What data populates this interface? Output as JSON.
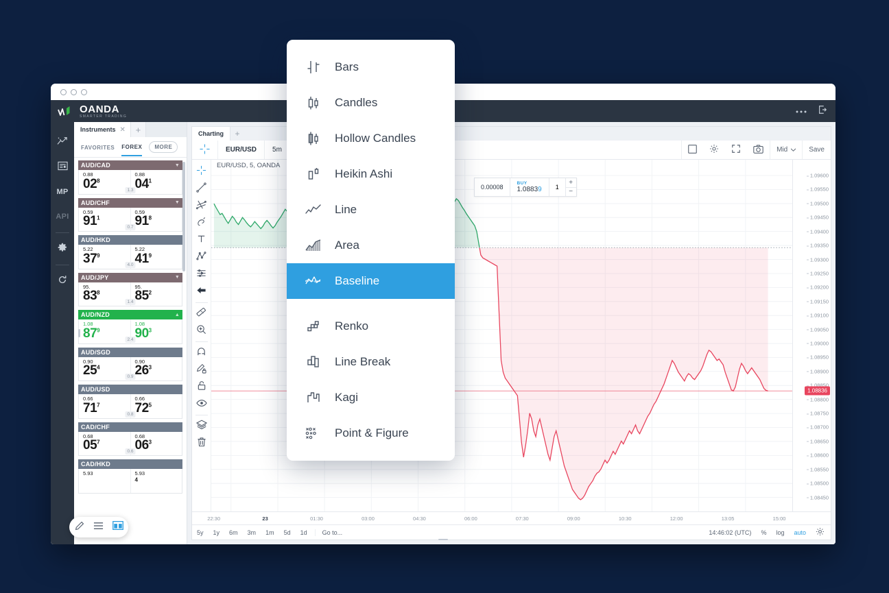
{
  "app": {
    "brand_name": "OANDA",
    "brand_tagline": "SMARTER TRADING",
    "more_icon": "ellipsis-icon",
    "logout_icon": "logout-icon"
  },
  "rail": {
    "items": [
      {
        "name": "rates-icon",
        "label": ""
      },
      {
        "name": "news-icon",
        "label": ""
      },
      {
        "name": "marketpulse-label",
        "label": "MP"
      },
      {
        "name": "api-label",
        "label": "API"
      },
      {
        "name": "settings-icon",
        "label": ""
      },
      {
        "name": "refresh-icon",
        "label": ""
      }
    ]
  },
  "instruments_panel": {
    "tab_label": "Instruments",
    "close_icon": "close-icon",
    "add_tab_icon": "plus-icon",
    "subtabs": [
      {
        "label": "FAVORITES",
        "active": false
      },
      {
        "label": "FOREX",
        "active": true
      },
      {
        "label": "MORE",
        "active": false
      }
    ],
    "rows": [
      {
        "symbol": "AUD/CAD",
        "dir": "down",
        "bid_pre": "0.88",
        "bid_big": "02",
        "bid_sup": "8",
        "ask_pre": "0.88",
        "ask_big": "04",
        "ask_sup": "1",
        "spread": "1.3"
      },
      {
        "symbol": "AUD/CHF",
        "dir": "down",
        "bid_pre": "0.59",
        "bid_big": "91",
        "bid_sup": "1",
        "ask_pre": "0.59",
        "ask_big": "91",
        "ask_sup": "8",
        "spread": "0.7"
      },
      {
        "symbol": "AUD/HKD",
        "dir": "flat",
        "bid_pre": "5.22",
        "bid_big": "37",
        "bid_sup": "9",
        "ask_pre": "5.22",
        "ask_big": "41",
        "ask_sup": "9",
        "spread": "4.0"
      },
      {
        "symbol": "AUD/JPY",
        "dir": "down",
        "bid_pre": "95.",
        "bid_big": "83",
        "bid_sup": "8",
        "ask_pre": "95.",
        "ask_big": "85",
        "ask_sup": "2",
        "spread": "1.4"
      },
      {
        "symbol": "AUD/NZD",
        "dir": "up",
        "bid_pre": "1.08",
        "bid_big": "87",
        "bid_sup": "9",
        "ask_pre": "1.08",
        "ask_big": "90",
        "ask_sup": "3",
        "spread": "2.4"
      },
      {
        "symbol": "AUD/SGD",
        "dir": "flat",
        "bid_pre": "0.90",
        "bid_big": "25",
        "bid_sup": "4",
        "ask_pre": "0.90",
        "ask_big": "26",
        "ask_sup": "3",
        "spread": "0.9"
      },
      {
        "symbol": "AUD/USD",
        "dir": "flat",
        "bid_pre": "0.66",
        "bid_big": "71",
        "bid_sup": "7",
        "ask_pre": "0.66",
        "ask_big": "72",
        "ask_sup": "5",
        "spread": "0.8"
      },
      {
        "symbol": "CAD/CHF",
        "dir": "flat",
        "bid_pre": "0.68",
        "bid_big": "05",
        "bid_sup": "7",
        "ask_pre": "0.68",
        "ask_big": "06",
        "ask_sup": "3",
        "spread": "0.6"
      },
      {
        "symbol": "CAD/HKD",
        "dir": "flat",
        "bid_pre": "5.93",
        "bid_big": "",
        "bid_sup": "",
        "ask_pre": "5.93",
        "ask_big": "",
        "ask_sup": "4",
        "spread": ""
      }
    ],
    "pill_icons": [
      "pencil-icon",
      "list-icon",
      "layout-icon"
    ]
  },
  "chart_panel": {
    "tab_label": "Charting",
    "add_tab_icon": "plus-icon",
    "toolbar": {
      "crosshair_icon": "crosshair-icon",
      "symbol": "EUR/USD",
      "interval": "5m",
      "right_icons": [
        "square-icon",
        "gear-icon",
        "fullscreen-icon",
        "camera-icon"
      ],
      "mid_label": "Mid",
      "save_label": "Save"
    },
    "plot_label": "EUR/USD, 5, OANDA",
    "tools": [
      "crosshair-icon",
      "trendline-icon",
      "fib-icon",
      "brush-icon",
      "text-icon",
      "pattern-icon",
      "forecast-icon",
      "arrow-icon",
      "ruler-icon",
      "zoom-in-icon",
      "magnet-icon",
      "draw-lock-icon",
      "lock-icon",
      "eye-icon",
      "layers-icon",
      "trash-icon"
    ],
    "ticket": {
      "spread": "0.00008",
      "side_label": "BUY",
      "price_main": "1.0883",
      "price_tail": "9",
      "quantity": "1",
      "plus": "+",
      "minus": "−"
    },
    "status": {
      "ranges": [
        "5y",
        "1y",
        "6m",
        "3m",
        "1m",
        "5d",
        "1d"
      ],
      "goto_label": "Go to...",
      "clock": "14:46:02 (UTC)",
      "percent_label": "%",
      "log_label": "log",
      "auto_label": "auto",
      "settings_icon": "gear-icon"
    }
  },
  "chart_data": {
    "type": "area",
    "title": "EUR/USD, 5, OANDA",
    "subtype": "baseline",
    "xlabel": "",
    "ylabel": "",
    "ylim": [
      1.08425,
      1.09625
    ],
    "baseline": 1.09325,
    "current_price": "1.08836",
    "grid": true,
    "colors": {
      "above": "#26a96a",
      "below": "#e8455e",
      "accent": "#2f9fe0",
      "current_marker": "#e8455e"
    },
    "y_ticks": [
      "1.09600",
      "1.09550",
      "1.09500",
      "1.09450",
      "1.09400",
      "1.09350",
      "1.09300",
      "1.09250",
      "1.09200",
      "1.09150",
      "1.09100",
      "1.09050",
      "1.09000",
      "1.08950",
      "1.08900",
      "1.08850",
      "1.08800",
      "1.08750",
      "1.08700",
      "1.08650",
      "1.08600",
      "1.08550",
      "1.08500",
      "1.08450"
    ],
    "x_ticks": [
      {
        "label": "22:30",
        "bold": false
      },
      {
        "label": "23",
        "bold": true
      },
      {
        "label": "01:30",
        "bold": false
      },
      {
        "label": "03:00",
        "bold": false
      },
      {
        "label": "04:30",
        "bold": false
      },
      {
        "label": "06:00",
        "bold": false
      },
      {
        "label": "07:30",
        "bold": false
      },
      {
        "label": "09:00",
        "bold": false
      },
      {
        "label": "10:30",
        "bold": false
      },
      {
        "label": "12:00",
        "bold": false
      },
      {
        "label": "13:05",
        "bold": false
      },
      {
        "label": "15:00",
        "bold": false
      }
    ],
    "values": [
      1.09475,
      1.09462,
      1.0945,
      1.09438,
      1.09442,
      1.0943,
      1.09418,
      1.09408,
      1.0942,
      1.09432,
      1.09424,
      1.09412,
      1.09404,
      1.09416,
      1.09428,
      1.0942,
      1.0941,
      1.09402,
      1.09396,
      1.09404,
      1.09414,
      1.09406,
      1.09398,
      1.0939,
      1.09398,
      1.0941,
      1.09418,
      1.0941,
      1.094,
      1.09392,
      1.094,
      1.09412,
      1.09422,
      1.09432,
      1.09444,
      1.09456,
      1.09448,
      1.09438,
      1.09446,
      1.09458,
      1.0947,
      1.09462,
      1.09452,
      1.09444,
      1.09436,
      1.09448,
      1.0946,
      1.09452,
      1.09442,
      1.09432,
      1.09444,
      1.09456,
      1.09468,
      1.09458,
      1.09446,
      1.09436,
      1.09448,
      1.0946,
      1.09472,
      1.09462,
      1.09452,
      1.09442,
      1.09454,
      1.09466,
      1.09478,
      1.0947,
      1.09458,
      1.09448,
      1.09438,
      1.0945,
      1.09462,
      1.09474,
      1.09466,
      1.09454,
      1.09444,
      1.09456,
      1.09468,
      1.0948,
      1.09472,
      1.0946,
      1.0945,
      1.0944,
      1.09452,
      1.09464,
      1.09476,
      1.09468,
      1.09456,
      1.09446,
      1.09458,
      1.0947,
      1.09482,
      1.09474,
      1.09462,
      1.09452,
      1.09464,
      1.09476,
      1.09488,
      1.09478,
      1.09466,
      1.09456,
      1.09468,
      1.0948,
      1.09492,
      1.09484,
      1.09472,
      1.09462,
      1.09472,
      1.09484,
      1.09496,
      1.09486,
      1.09474,
      1.09464,
      1.09476,
      1.09488,
      1.095,
      1.0949,
      1.09478,
      1.09468,
      1.0948,
      1.09492,
      1.09486,
      1.09474,
      1.09462,
      1.09452,
      1.0944,
      1.0943,
      1.0942,
      1.0941,
      1.094,
      1.0938,
      1.0934,
      1.093,
      1.0929,
      1.09286,
      1.09282,
      1.09278,
      1.09274,
      1.0927,
      1.09266,
      1.09262,
      1.091,
      1.0894,
      1.089,
      1.0888,
      1.0887,
      1.0886,
      1.0885,
      1.0884,
      1.0883,
      1.0882,
      1.0874,
      1.0866,
      1.0861,
      1.0865,
      1.087,
      1.0876,
      1.0874,
      1.087,
      1.0868,
      1.0872,
      1.0874,
      1.0871,
      1.0868,
      1.0865,
      1.0862,
      1.086,
      1.0864,
      1.0868,
      1.087,
      1.0867,
      1.0864,
      1.0861,
      1.0858,
      1.0856,
      1.0854,
      1.0852,
      1.085,
      1.0849,
      1.0848,
      1.0847,
      1.08465,
      1.0847,
      1.0848,
      1.08495,
      1.0851,
      1.0852,
      1.0853,
      1.08545,
      1.08555,
      1.0856,
      1.0857,
      1.08585,
      1.086,
      1.0859,
      1.086,
      1.08615,
      1.0863,
      1.0862,
      1.08635,
      1.0865,
      1.08665,
      1.08655,
      1.0867,
      1.08685,
      1.087,
      1.0869,
      1.08705,
      1.0872,
      1.087,
      1.0869,
      1.08705,
      1.0872,
      1.08735,
      1.0875,
      1.0876,
      1.08775,
      1.0879,
      1.088,
      1.08815,
      1.0883,
      1.08845,
      1.0886,
      1.0888,
      1.089,
      1.0892,
      1.0894,
      1.0893,
      1.08915,
      1.089,
      1.0889,
      1.0888,
      1.0887,
      1.08885,
      1.08895,
      1.0889,
      1.0888,
      1.08875,
      1.08885,
      1.08895,
      1.08905,
      1.0892,
      1.0894,
      1.0896,
      1.08975,
      1.0897,
      1.0896,
      1.0895,
      1.0894,
      1.08945,
      1.08935,
      1.08925,
      1.089,
      1.0888,
      1.0886,
      1.0884,
      1.08836,
      1.0885,
      1.0888,
      1.0891,
      1.0893,
      1.0892,
      1.08905,
      1.08895,
      1.08905,
      1.08915,
      1.08905,
      1.08895,
      1.08885,
      1.08875,
      1.0886,
      1.08845,
      1.08838,
      1.08836
    ]
  },
  "menu": {
    "items": [
      {
        "label": "Bars",
        "icon": "bars-chart-icon",
        "active": false,
        "gap_after": false
      },
      {
        "label": "Candles",
        "icon": "candles-chart-icon",
        "active": false,
        "gap_after": false
      },
      {
        "label": "Hollow Candles",
        "icon": "hollow-candles-icon",
        "active": false,
        "gap_after": false
      },
      {
        "label": "Heikin Ashi",
        "icon": "heikin-ashi-icon",
        "active": false,
        "gap_after": false
      },
      {
        "label": "Line",
        "icon": "line-chart-icon",
        "active": false,
        "gap_after": false
      },
      {
        "label": "Area",
        "icon": "area-chart-icon",
        "active": false,
        "gap_after": false
      },
      {
        "label": "Baseline",
        "icon": "baseline-chart-icon",
        "active": true,
        "gap_after": true
      },
      {
        "label": "Renko",
        "icon": "renko-chart-icon",
        "active": false,
        "gap_after": false
      },
      {
        "label": "Line Break",
        "icon": "line-break-chart-icon",
        "active": false,
        "gap_after": false
      },
      {
        "label": "Kagi",
        "icon": "kagi-chart-icon",
        "active": false,
        "gap_after": false
      },
      {
        "label": "Point & Figure",
        "icon": "point-figure-icon",
        "active": false,
        "gap_after": false
      }
    ]
  }
}
